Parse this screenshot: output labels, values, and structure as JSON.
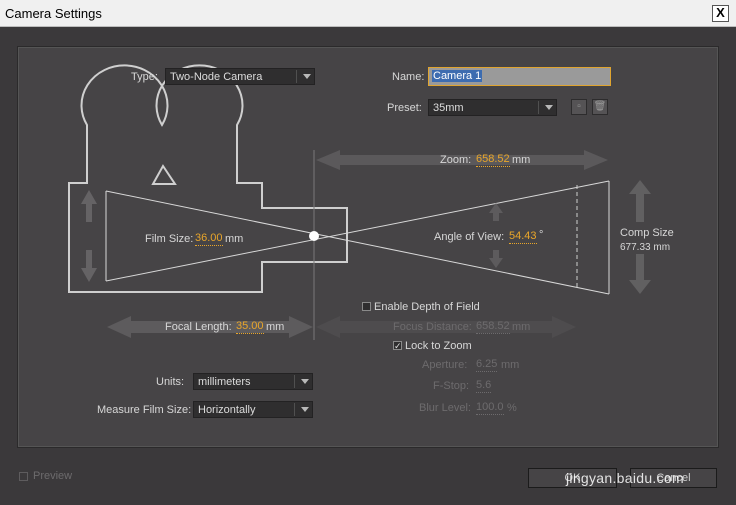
{
  "window": {
    "title": "Camera Settings",
    "close_glyph": "X"
  },
  "type": {
    "label": "Type:",
    "value": "Two-Node Camera"
  },
  "name": {
    "label": "Name:",
    "value": "Camera 1"
  },
  "preset": {
    "label": "Preset:",
    "value": "35mm"
  },
  "zoom": {
    "label": "Zoom:",
    "value": "658.52",
    "unit": "mm"
  },
  "film_size": {
    "label": "Film Size:",
    "value": "36.00",
    "unit": "mm"
  },
  "angle_of_view": {
    "label": "Angle of View:",
    "value": "54.43",
    "unit": "°"
  },
  "comp_size": {
    "label": "Comp Size",
    "value": "677.33 mm"
  },
  "focal_length": {
    "label": "Focal Length:",
    "value": "35.00",
    "unit": "mm"
  },
  "depth_of_field": {
    "label": "Enable Depth of Field",
    "checked": false
  },
  "focus_distance": {
    "label": "Focus Distance:",
    "value": "658.52",
    "unit": "mm"
  },
  "lock_to_zoom": {
    "label": "Lock to Zoom",
    "checked": true,
    "check_glyph": "✓"
  },
  "aperture": {
    "label": "Aperture:",
    "value": "6.25",
    "unit": "mm"
  },
  "f_stop": {
    "label": "F-Stop:",
    "value": "5.6"
  },
  "blur_level": {
    "label": "Blur Level:",
    "value": "100.0",
    "unit": "%"
  },
  "units": {
    "label": "Units:",
    "value": "millimeters"
  },
  "measure_film_size": {
    "label": "Measure Film Size:",
    "value": "Horizontally"
  },
  "preview": {
    "label": "Preview",
    "checked": false
  },
  "buttons": {
    "ok": "OK",
    "cancel": "Cancel"
  },
  "watermark": "jingyan.baidu.com",
  "colors": {
    "accent_value": "#e9a62a",
    "selection": "#3d6cb0",
    "focus_border": "#e0a530"
  }
}
